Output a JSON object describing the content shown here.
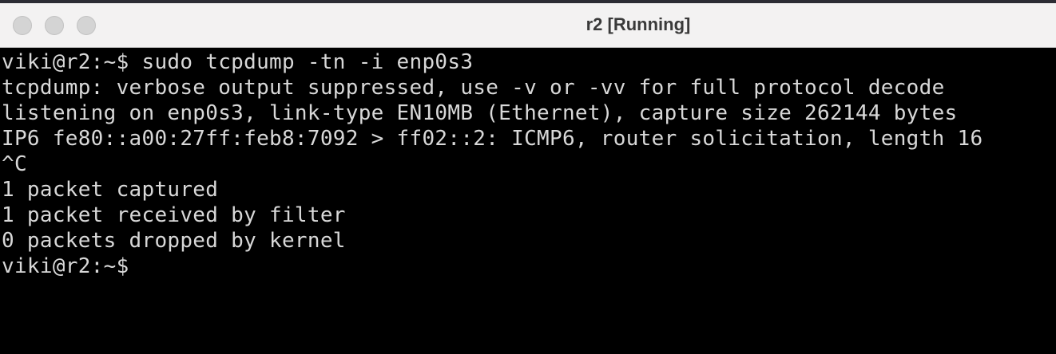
{
  "window": {
    "title": "r2 [Running]"
  },
  "terminal": {
    "lines": [
      "viki@r2:~$ sudo tcpdump -tn -i enp0s3",
      "tcpdump: verbose output suppressed, use -v or -vv for full protocol decode",
      "listening on enp0s3, link-type EN10MB (Ethernet), capture size 262144 bytes",
      "IP6 fe80::a00:27ff:feb8:7092 > ff02::2: ICMP6, router solicitation, length 16",
      "^C",
      "1 packet captured",
      "1 packet received by filter",
      "0 packets dropped by kernel",
      "viki@r2:~$"
    ]
  },
  "colors": {
    "background": "#000000",
    "text": "#d8d8d8",
    "titlebar": "#f3f2f2"
  }
}
